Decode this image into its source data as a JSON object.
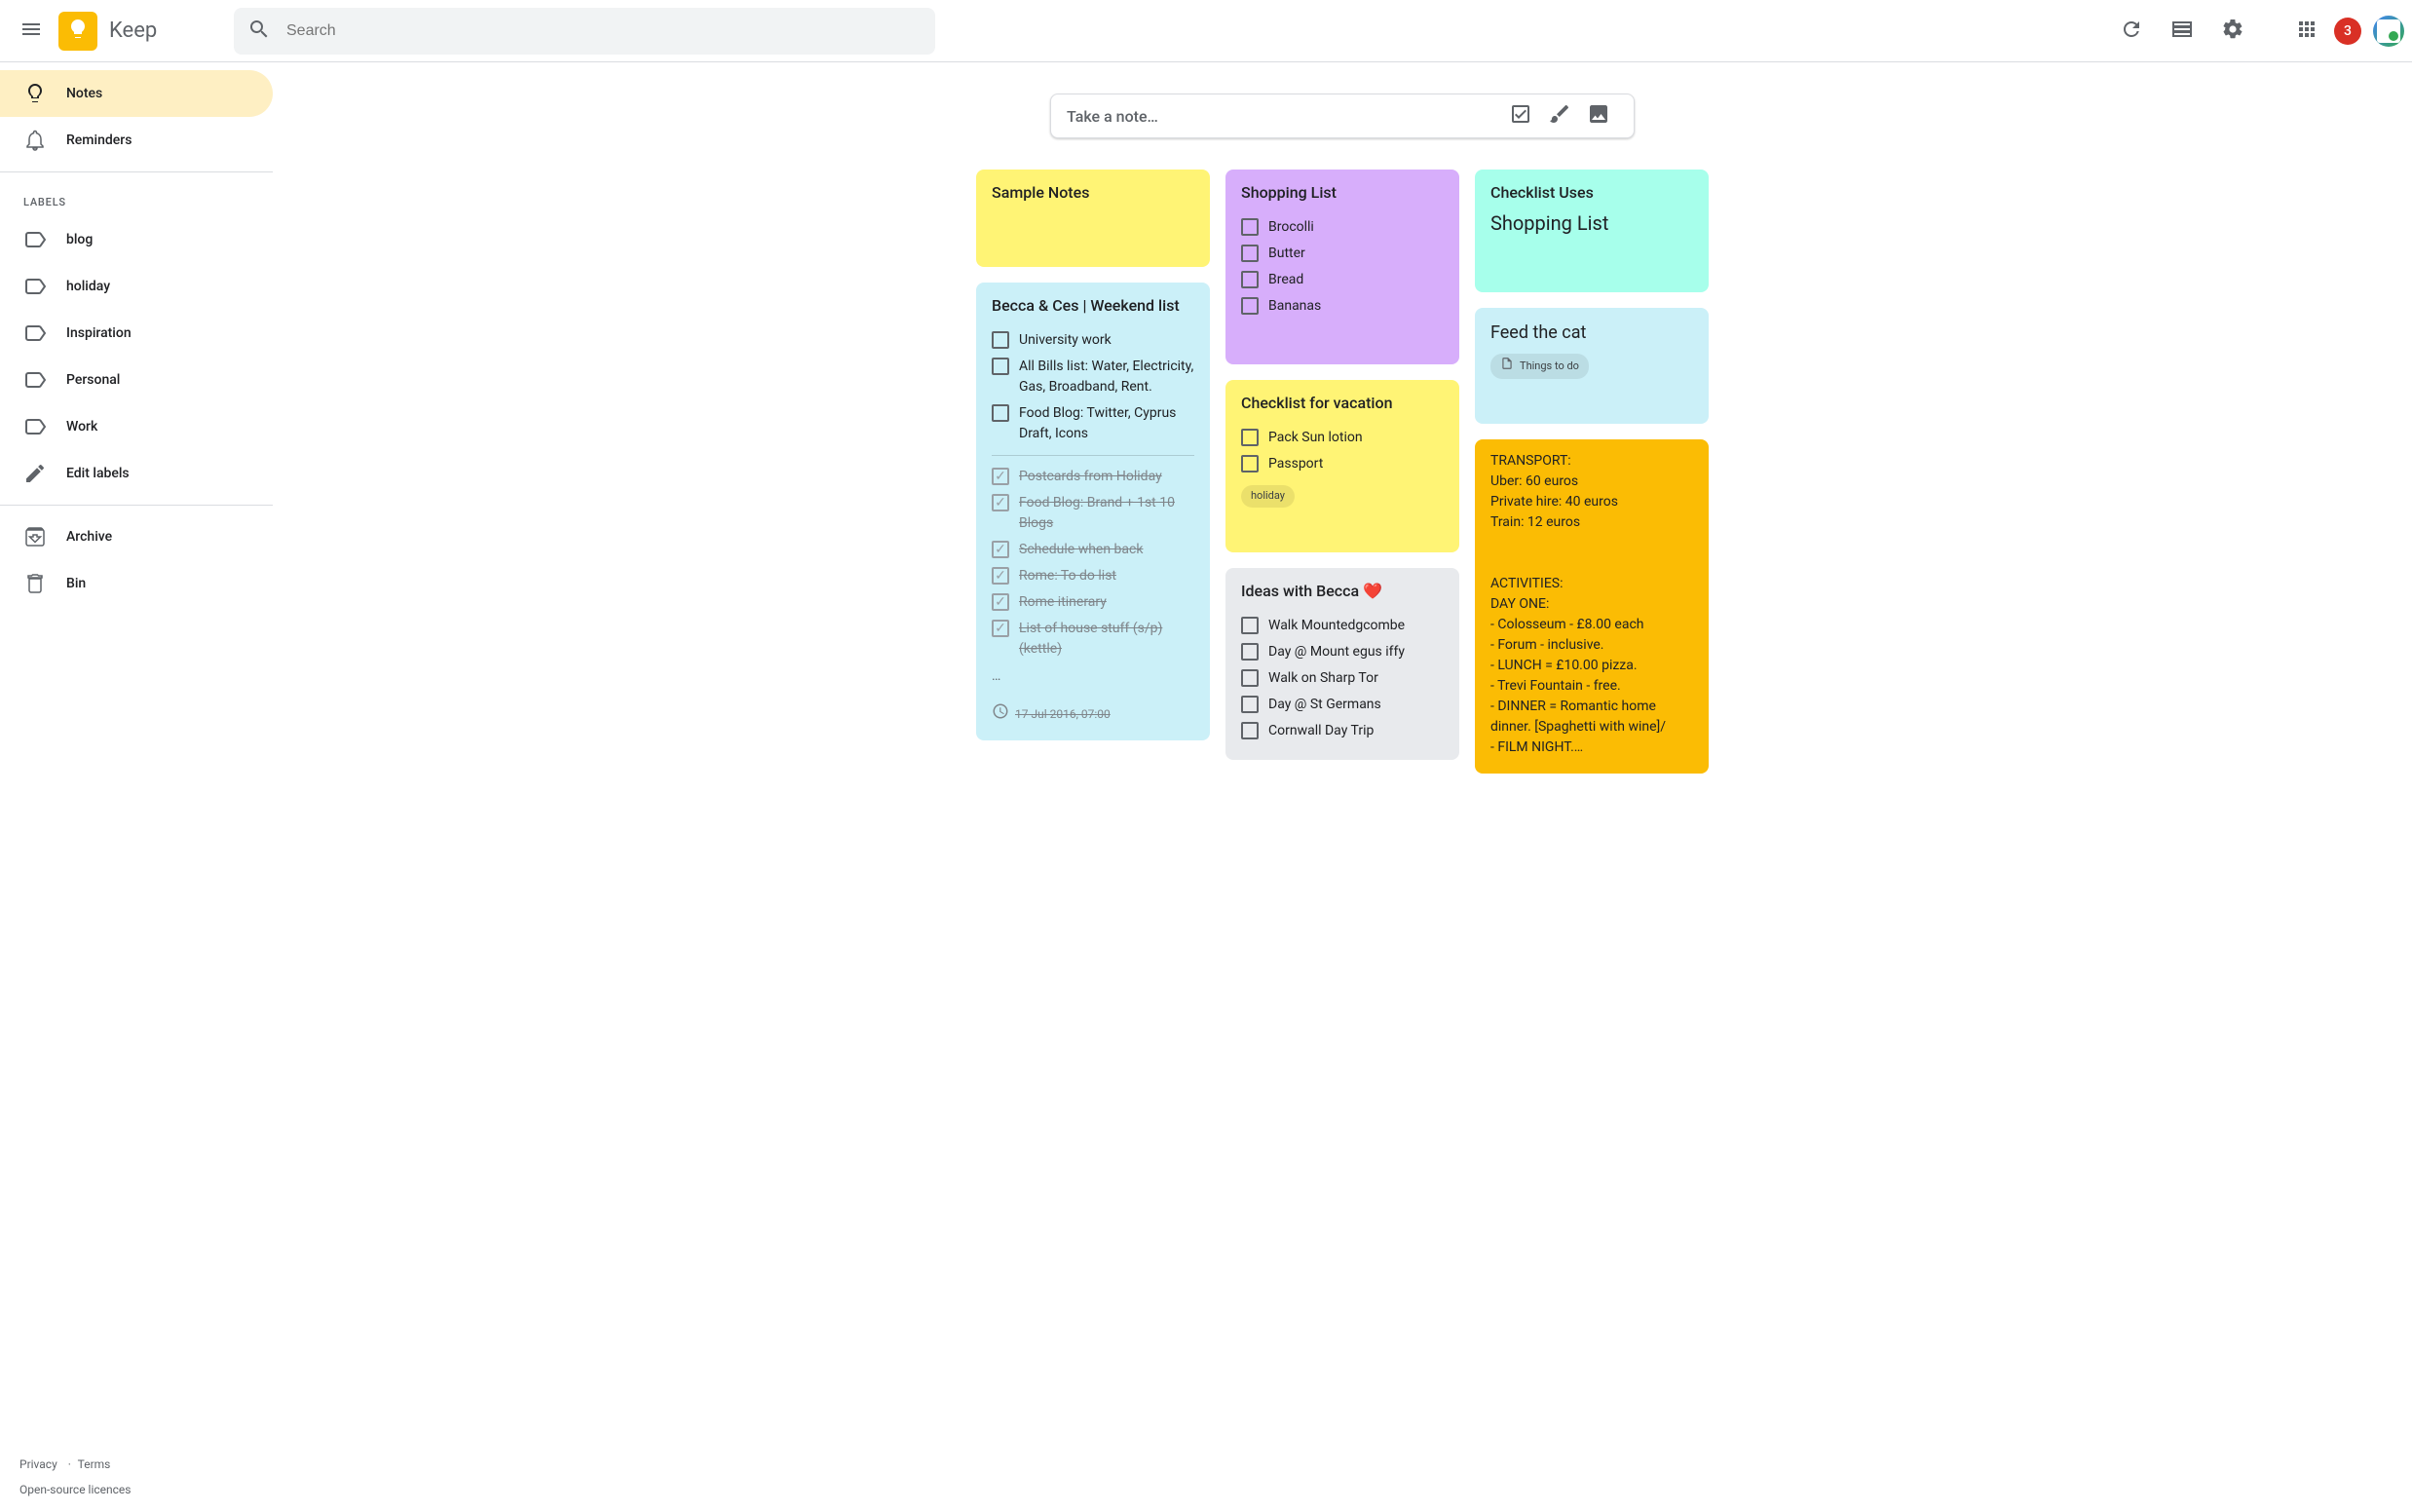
{
  "header": {
    "app_name": "Keep",
    "search_placeholder": "Search",
    "notif_count": "3"
  },
  "sidebar": {
    "items": [
      {
        "label": "Notes",
        "icon": "bulb",
        "active": true
      },
      {
        "label": "Reminders",
        "icon": "bell",
        "active": false
      }
    ],
    "labels_heading": "LABELS",
    "labels": [
      {
        "label": "blog"
      },
      {
        "label": "holiday"
      },
      {
        "label": "Inspiration"
      },
      {
        "label": "Personal"
      },
      {
        "label": "Work"
      }
    ],
    "edit_labels": "Edit labels",
    "archive": "Archive",
    "bin": "Bin",
    "footer": {
      "privacy": "Privacy",
      "terms": "Terms",
      "licences": "Open-source licences"
    }
  },
  "take_note": {
    "placeholder": "Take a note…"
  },
  "notes": {
    "col1": {
      "sample": {
        "title": "Sample Notes"
      },
      "weekend": {
        "title": "Becca & Ces | Weekend list",
        "unchecked": [
          "University work",
          "All Bills list: Water, Electricity, Gas, Broadband, Rent.",
          "Food Blog: Twitter, Cyprus Draft, Icons"
        ],
        "checked": [
          "Postcards from Holiday",
          "Food Blog: Brand + 1st 10 Blogs",
          "Schedule when back",
          "Rome: To do list",
          "Rome itinerary",
          "List of house stuff (s/p) (kettle)"
        ],
        "more": "…",
        "timestamp": "17 Jul 2016, 07:00"
      }
    },
    "col2": {
      "shopping": {
        "title": "Shopping List",
        "items": [
          "Brocolli",
          "Butter",
          "Bread",
          "Bananas"
        ]
      },
      "vacation": {
        "title": "Checklist for vacation",
        "items": [
          "Pack Sun lotion",
          "Passport"
        ],
        "chip": "holiday"
      },
      "ideas": {
        "title": "Ideas with Becca ❤️",
        "items": [
          "Walk Mountedgcombe",
          "Day @ Mount egus iffy",
          "Walk on Sharp Tor",
          "Day @ St Germans",
          "Cornwall Day Trip"
        ]
      }
    },
    "col3": {
      "checklist_uses": {
        "title": "Checklist Uses",
        "body": "Shopping List"
      },
      "feedcat": {
        "title": "Feed the cat",
        "chip": "Things to do"
      },
      "orange": {
        "body": "TRANSPORT:\nUber: 60 euros\nPrivate hire: 40 euros\nTrain: 12 euros\n\n\nACTIVITIES:\nDAY ONE:\n- Colosseum - £8.00 each\n- Forum - inclusive.\n- LUNCH = £10.00 pizza.\n- Trevi Fountain - free.\n- DINNER = Romantic home dinner. [Spaghetti with wine]/\n- FILM NIGHT.…"
      }
    }
  }
}
